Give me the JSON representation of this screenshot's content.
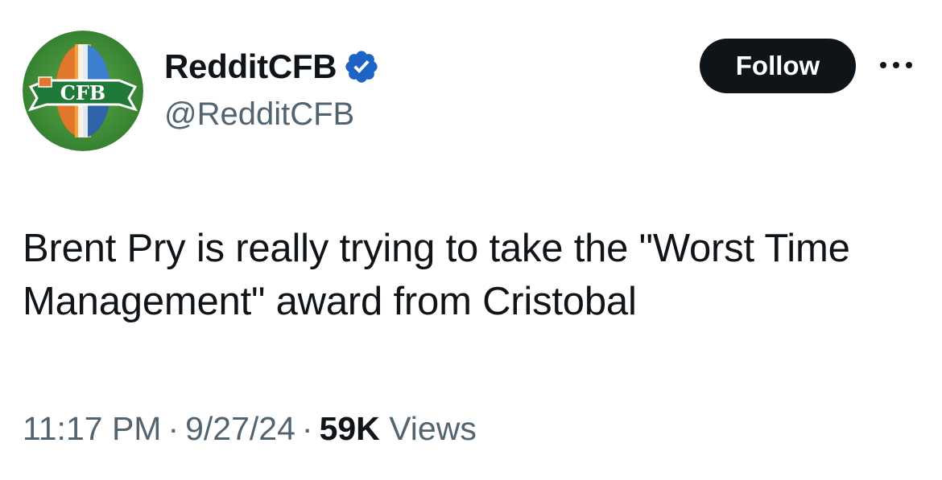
{
  "author": {
    "display_name": "RedditCFB",
    "handle": "@RedditCFB",
    "verified": true,
    "avatar_text": "CFB"
  },
  "actions": {
    "follow_label": "Follow",
    "more_icon": "more-horizontal-icon"
  },
  "tweet": {
    "text": "Brent Pry is really trying to take the \"Worst Time Management\" award from Cristobal"
  },
  "meta": {
    "time": "11:17 PM",
    "separator": "·",
    "date": "9/27/24",
    "views_count": "59K",
    "views_label": "Views"
  },
  "colors": {
    "verified_badge": "#1d63c4",
    "follow_button_bg": "#0f1419",
    "secondary_text": "#536471",
    "avatar_ring": "#3a8a34"
  }
}
